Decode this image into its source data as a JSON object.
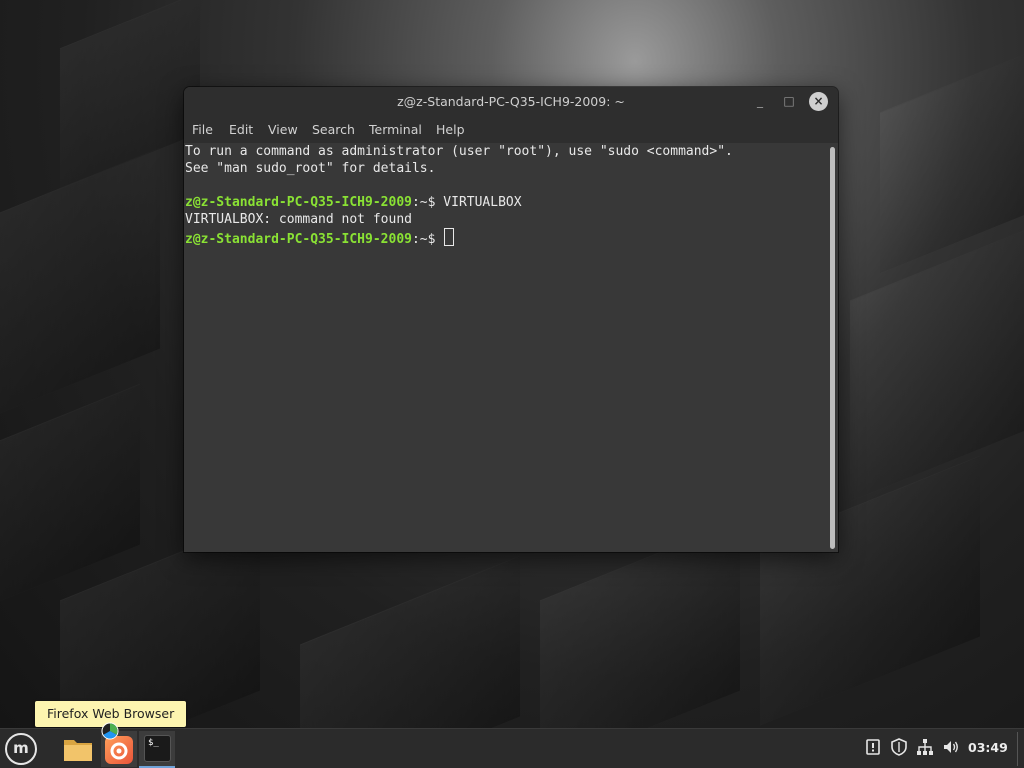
{
  "window": {
    "title": "z@z-Standard-PC-Q35-ICH9-2009: ~",
    "minimize_glyph": "_",
    "maximize_glyph": "□",
    "close_glyph": "×"
  },
  "menubar": {
    "items": [
      "File",
      "Edit",
      "View",
      "Search",
      "Terminal",
      "Help"
    ]
  },
  "terminal": {
    "line1": "To run a command as administrator (user \"root\"), use \"sudo <command>\".",
    "line2": "See \"man sudo_root\" for details.",
    "prompt_user": "z@z-Standard-PC-Q35-ICH9-2009",
    "prompt_path": ":~$ ",
    "command": "VIRTUALBOX",
    "output": "VIRTUALBOX: command not found"
  },
  "tooltip": {
    "text": "Firefox Web Browser"
  },
  "taskbar": {
    "menu_glyph": "m",
    "terminal_icon_text": "$_",
    "clock": "03:49",
    "icons": {
      "menu": "mint-menu-icon",
      "files": "folder-icon",
      "browser": "firefox-icon",
      "terminal": "terminal-icon",
      "tray": [
        "update-manager-icon",
        "shield-icon",
        "network-icon",
        "volume-icon"
      ]
    }
  },
  "colors": {
    "prompt_green": "#8ae234",
    "tooltip_bg": "#fdf5b0",
    "terminal_bg": "#383838"
  }
}
